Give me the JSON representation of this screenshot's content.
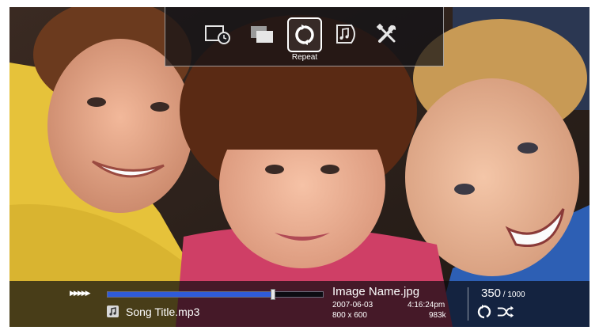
{
  "menu": {
    "items": [
      {
        "name": "slideshow-timer",
        "icon": "slideshow-clock-icon"
      },
      {
        "name": "transition",
        "icon": "transition-icon"
      },
      {
        "name": "repeat",
        "icon": "repeat-icon",
        "label": "Repeat"
      },
      {
        "name": "background-music",
        "icon": "music-icon"
      },
      {
        "name": "settings",
        "icon": "tools-icon"
      }
    ],
    "selected_label": "Repeat"
  },
  "playback": {
    "speed_indicator": "▶▶▶▶▶",
    "progress_percent": 77
  },
  "music": {
    "icon": "music-note-icon",
    "song_title": "Song Title.mp3"
  },
  "image": {
    "name": "Image Name.jpg",
    "date": "2007-06-03",
    "time": "4:16:24pm",
    "dimensions": "800 x 600",
    "size": "983k"
  },
  "counter": {
    "current": "350",
    "separator": " / ",
    "total": "1000"
  },
  "status_icons": [
    "repeat-icon",
    "shuffle-icon"
  ],
  "colors": {
    "progress_fill": "#2f5bd8",
    "overlay": "#0a0a0e"
  }
}
